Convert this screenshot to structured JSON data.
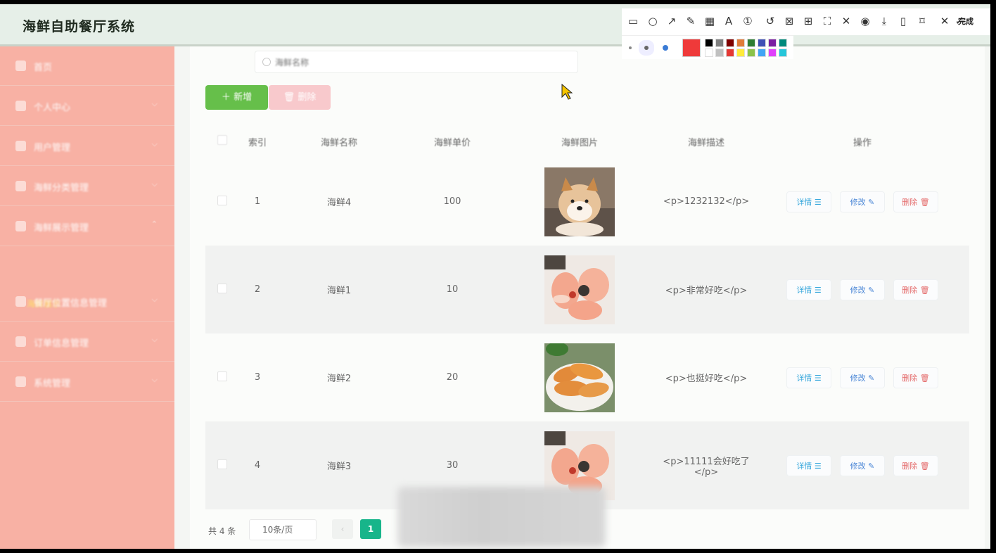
{
  "app": {
    "title": "海鲜自助餐厅系统"
  },
  "sidebar": {
    "items": [
      {
        "label": "首页",
        "icon": "home-icon"
      },
      {
        "label": "个人中心",
        "icon": "person-icon"
      },
      {
        "label": "用户管理",
        "icon": "list-icon"
      },
      {
        "label": "海鲜分类管理",
        "icon": "pin-icon"
      },
      {
        "label": "海鲜展示管理",
        "icon": "box-icon"
      },
      {
        "label": "餐厅位置信息管理",
        "icon": "building-icon"
      },
      {
        "label": "订单信息管理",
        "icon": "doc-icon"
      },
      {
        "label": "系统管理",
        "icon": "settings-icon"
      }
    ],
    "active_sub": "海鲜展示"
  },
  "search": {
    "placeholder": "海鲜名称"
  },
  "actions": {
    "add": "新增",
    "delete": "删除"
  },
  "table": {
    "columns": [
      "索引",
      "海鲜名称",
      "海鲜单价",
      "海鲜图片",
      "海鲜描述",
      "操作"
    ],
    "rows": [
      {
        "index": "1",
        "name": "海鲜4",
        "price": "100",
        "desc": "<p>1232132</p>",
        "image": "shiba-dog-photo"
      },
      {
        "index": "2",
        "name": "海鲜1",
        "price": "10",
        "desc": "<p>非常好吃</p>",
        "image": "salmon-dish-photo"
      },
      {
        "index": "3",
        "name": "海鲜2",
        "price": "20",
        "desc": "<p>也挺好吃</p>",
        "image": "shrimp-dish-photo"
      },
      {
        "index": "4",
        "name": "海鲜3",
        "price": "30",
        "desc": "<p>11111会好吃了</p>",
        "image": "salmon-dish-photo"
      }
    ],
    "row_actions": {
      "detail": "详情",
      "edit": "修改",
      "remove": "删除"
    }
  },
  "pagination": {
    "total": "共 4 条",
    "page_size": "10条/页",
    "current_page": "1",
    "prev": "‹"
  },
  "screenshot_tool": {
    "tools": [
      "rectangle-icon",
      "ellipse-icon",
      "arrow-icon",
      "pencil-icon",
      "mosaic-icon",
      "text-icon",
      "number-icon",
      "undo-icon",
      "ocr-icon",
      "translate-icon",
      "scan-icon",
      "pin-icon",
      "record-icon",
      "download-icon",
      "phone-icon",
      "bookmark-icon",
      "close-icon"
    ],
    "done_label": "完成",
    "selected_color": "#ef3a3a",
    "palette": [
      "#000000",
      "#808080",
      "#800000",
      "#e07b39",
      "#2e7d32",
      "#3f51b5",
      "#7b1fa2",
      "#00897b",
      "#ffffff",
      "#c0c0c0",
      "#e53935",
      "#ffeb3b",
      "#8bc34a",
      "#42a5f5",
      "#e040fb",
      "#26c6da"
    ]
  },
  "colors": {
    "sidebar": "#f8b1a4",
    "add_button": "#66bf4a",
    "page_active": "#17b58a"
  }
}
